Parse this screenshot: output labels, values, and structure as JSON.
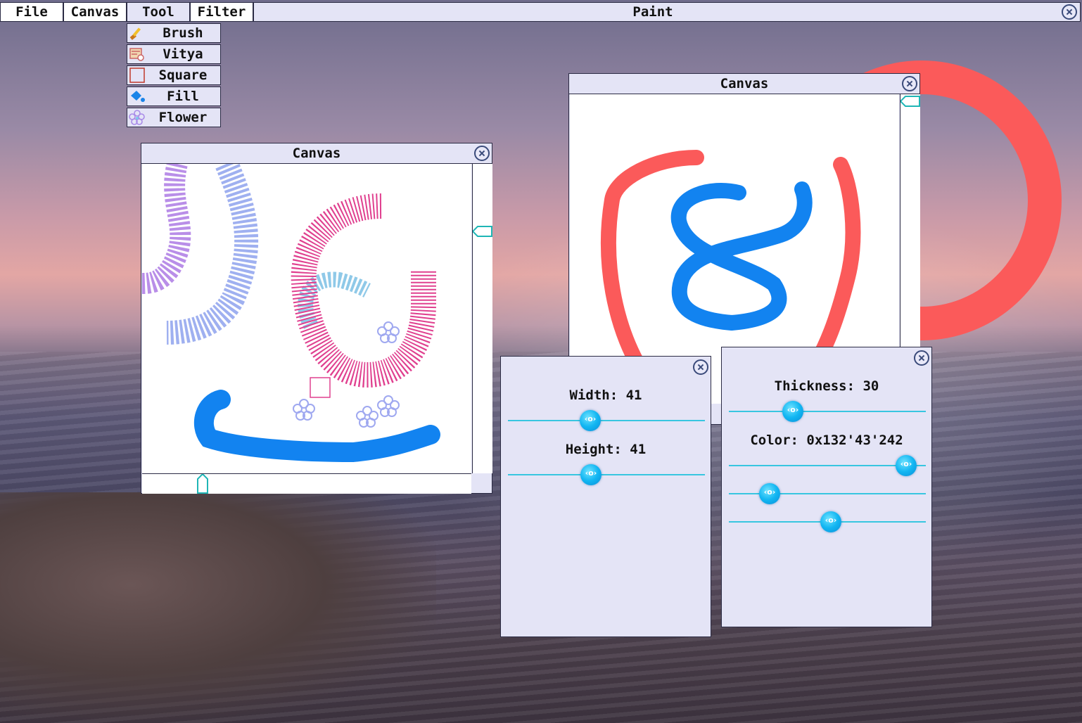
{
  "menubar": {
    "items": [
      "File",
      "Canvas",
      "Tool",
      "Filter"
    ],
    "app_title": "Paint"
  },
  "tools": {
    "items": [
      {
        "label": "Brush",
        "icon": "brush-icon"
      },
      {
        "label": "Vitya",
        "icon": "vitya-icon"
      },
      {
        "label": "Square",
        "icon": "square-icon"
      },
      {
        "label": "Fill",
        "icon": "fill-bucket-icon"
      },
      {
        "label": "Flower",
        "icon": "flower-icon"
      }
    ]
  },
  "canvas_left": {
    "title": "Canvas"
  },
  "canvas_right": {
    "title": "Canvas"
  },
  "size_panel": {
    "width_label": "Width: 41",
    "height_label": "Height: 41",
    "width_value": 41,
    "height_value": 41
  },
  "brush_panel": {
    "thickness_label": "Thickness: 30",
    "thickness_value": 30,
    "color_label": "Color: 0x132'43'242",
    "color_r": 132,
    "color_g": 43,
    "color_b": 242
  },
  "colors": {
    "panel_bg": "#e4e4f6",
    "accent_cyan": "#38c6e0",
    "stroke_red": "#fb5a5a",
    "stroke_blue": "#1283f0",
    "stroke_pink": "#e0408f"
  }
}
